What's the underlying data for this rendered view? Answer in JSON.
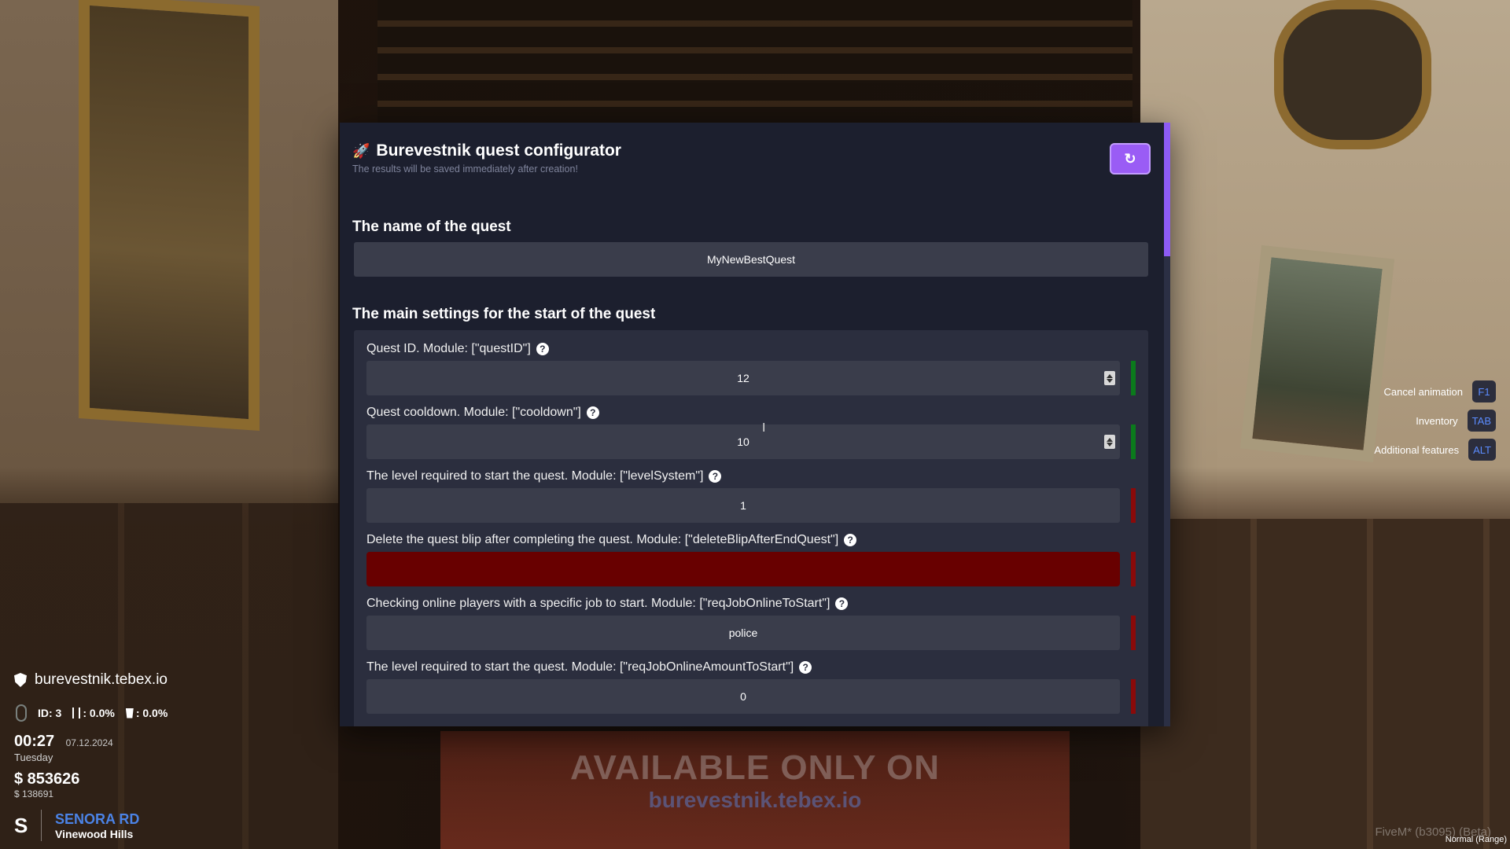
{
  "modal": {
    "title": "Burevestnik quest configurator",
    "subtitle": "The results will be saved immediately after creation!",
    "refresh_icon": "↻"
  },
  "quest_name": {
    "section_title": "The name of the quest",
    "value": "MyNewBestQuest"
  },
  "main_settings": {
    "section_title": "The main settings for the start of the quest",
    "fields": [
      {
        "label": "Quest ID. Module: [\"questID\"]",
        "value": "12",
        "type": "number",
        "status_color": "#0b7a1c"
      },
      {
        "label": "Quest cooldown. Module: [\"cooldown\"]",
        "value": "10",
        "type": "number",
        "status_color": "#0b7a1c"
      },
      {
        "label": "The level required to start the quest. Module: [\"levelSystem\"]",
        "value": "1",
        "type": "text",
        "status_color": "#8a0a0a"
      },
      {
        "label": "Delete the quest blip after completing the quest. Module: [\"deleteBlipAfterEndQuest\"]",
        "value": "",
        "type": "toggle",
        "fill_color": "#680000",
        "status_color": "#8a0a0a"
      },
      {
        "label": "Checking online players with a specific job to start. Module: [\"reqJobOnlineToStart\"]",
        "value": "police",
        "type": "text",
        "status_color": "#8a0a0a"
      },
      {
        "label": "The level required to start the quest. Module: [\"reqJobOnlineAmountToStart\"]",
        "value": "0",
        "type": "text",
        "status_color": "#8a0a0a"
      }
    ]
  },
  "hud": {
    "site": "burevestnik.tebex.io",
    "id": "ID: 3",
    "hunger": ": 0.0%",
    "thirst": ": 0.0%",
    "time": "00:27",
    "date": "07.12.2024",
    "weekday": "Tuesday",
    "cash": "$ 853626",
    "bank": "$ 138691",
    "direction": "S",
    "street": "SENORA RD",
    "area": "Vinewood Hills"
  },
  "keybinds": [
    {
      "label": "Cancel animation",
      "key": "F1"
    },
    {
      "label": "Inventory",
      "key": "TAB"
    },
    {
      "label": "Additional features",
      "key": "ALT"
    }
  ],
  "watermark": {
    "line1": "AVAILABLE ONLY ON",
    "line2": "burevestnik.tebex.io"
  },
  "footer": {
    "build": "FiveM* (b3095) (Beta)",
    "mode": "Normal (Range)"
  },
  "colors": {
    "accent": "#9a5cf5",
    "panel": "#1c1f2e",
    "ok": "#0b7a1c",
    "error": "#8a0a0a"
  }
}
